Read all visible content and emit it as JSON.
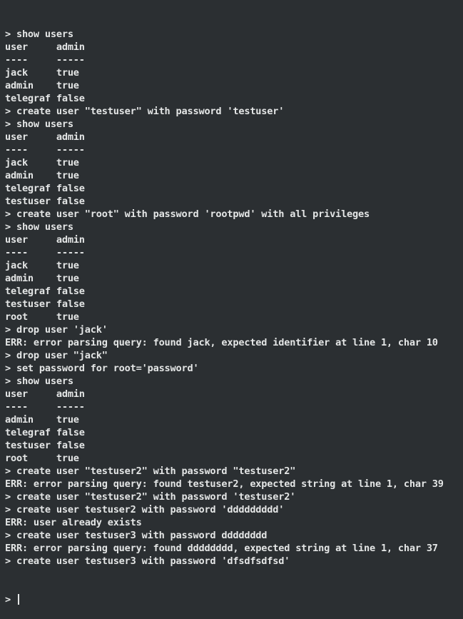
{
  "terminal": {
    "lines": [
      "> show users",
      "user     admin",
      "----     -----",
      "jack     true",
      "admin    true",
      "telegraf false",
      "> create user \"testuser\" with password 'testuser'",
      "> show users",
      "user     admin",
      "----     -----",
      "jack     true",
      "admin    true",
      "telegraf false",
      "testuser false",
      "> create user \"root\" with password 'rootpwd' with all privileges",
      "> show users",
      "user     admin",
      "----     -----",
      "jack     true",
      "admin    true",
      "telegraf false",
      "testuser false",
      "root     true",
      "> drop user 'jack'",
      "ERR: error parsing query: found jack, expected identifier at line 1, char 10",
      "> drop user \"jack\"",
      "> set password for root='password'",
      "> show users",
      "user     admin",
      "----     -----",
      "admin    true",
      "telegraf false",
      "testuser false",
      "root     true",
      "> create user \"testuser2\" with password \"testuser2\"",
      "ERR: error parsing query: found testuser2, expected string at line 1, char 39",
      "> create user \"testuser2\" with password 'testuser2'",
      "> create user testuser2 with password 'ddddddddd'",
      "ERR: user already exists",
      "> create user testuser3 with password dddddddd",
      "ERR: error parsing query: found dddddddd, expected string at line 1, char 37",
      "> create user testuser3 with password 'dfsdfsdfsd'"
    ],
    "prompt": "> "
  }
}
